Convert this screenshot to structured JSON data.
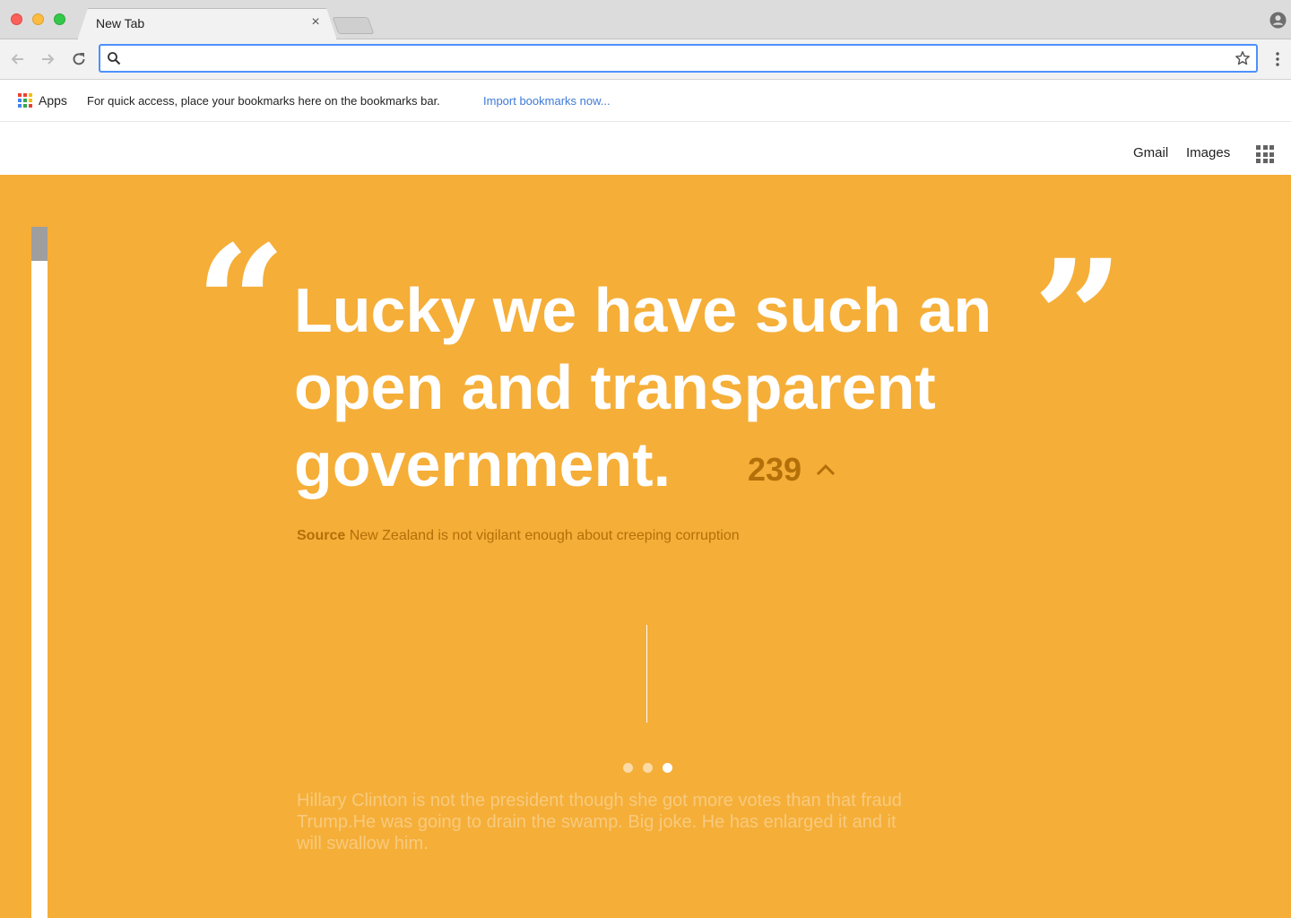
{
  "browser": {
    "tab_title": "New Tab",
    "tab_close": "×",
    "omnibox": {
      "value": "",
      "placeholder": ""
    },
    "icons": {
      "back": "arrow-left-icon",
      "forward": "arrow-right-icon",
      "reload": "reload-icon",
      "search": "search-icon",
      "star": "star-icon",
      "menu": "kebab-menu-icon",
      "profile": "profile-icon"
    }
  },
  "bookmarks": {
    "apps_label": "Apps",
    "hint": "For quick access, place your bookmarks here on the bookmarks bar.",
    "import_link": "Import bookmarks now..."
  },
  "google_header": {
    "gmail": "Gmail",
    "images": "Images"
  },
  "quote": {
    "open_mark": "“",
    "close_mark": "”",
    "lines": [
      "Lucky we have such an",
      "open and transparent",
      "government."
    ],
    "votes": "239",
    "source_label": "Source",
    "source_text": "New Zealand is not vigilant enough about creeping corruption"
  },
  "pager": {
    "count": 3,
    "active_index": 2
  },
  "next_quote": {
    "text": "Hillary Clinton is not the president though she got more votes than that fraud Trump.He was going to drain the swamp. Big joke. He has enlarged it and it will swallow him."
  },
  "colors": {
    "background": "#f5ae38",
    "quote_text": "#ffffff",
    "accent_dark": "#b36f08",
    "omnibox_focus": "#4d90fe",
    "link_blue": "#3d7ad6"
  }
}
